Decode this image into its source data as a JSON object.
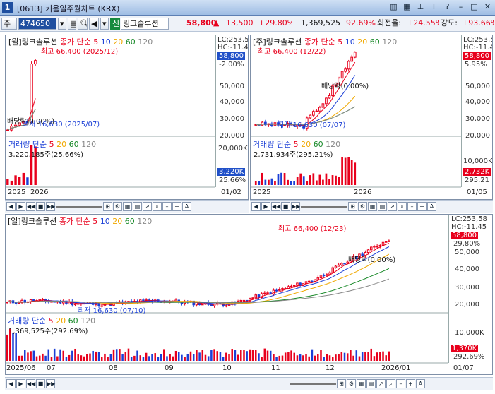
{
  "window": {
    "number": "1",
    "title": "[0613] 키움일주월차트 (KRX)"
  },
  "toolbar": {
    "market": "주",
    "code": "474650",
    "badge": "신",
    "name": "링크솔루션",
    "price": "58,800",
    "change": "13,500",
    "change_pct": "+29.80%",
    "volume": "1,369,525",
    "volume_pct": "92.69%",
    "turnover_label": "회전율:",
    "turnover": "+24.55%",
    "strength_label": "강도:",
    "strength": "+93.66%"
  },
  "panels": {
    "monthly": {
      "title": "[월]링크솔루션",
      "ma_label": "종가 단순",
      "ma": [
        "5",
        "10",
        "20",
        "60",
        "120"
      ],
      "high": "최고 66,400 (2025/12)",
      "low": "최저 16,630 (2025/07)",
      "low_marker": "배당락(0.00%)",
      "lc": "LC:253,5",
      "hc": "HC:-11.4",
      "price_tag": "58,800",
      "pct_tag": "-2.00%",
      "yticks": [
        "50,000",
        "40,000",
        "30,000",
        "20,000"
      ],
      "vol_title": "거래량",
      "vol_ma_label": "단순",
      "vol_ma": [
        "5",
        "20",
        "60",
        "120"
      ],
      "vol_value": "3,220,185주(25.66%)",
      "vol_ytick": "20,000K",
      "vol_tag": "3,220K",
      "vol_pct": "25.66%",
      "xlabels": [
        "2025",
        "2026"
      ],
      "date": "01/02"
    },
    "weekly": {
      "title": "[주]링크솔루션",
      "ma_label": "종가 단순",
      "ma": [
        "5",
        "10",
        "20",
        "60",
        "120"
      ],
      "high": "최고 66,400 (12/22)",
      "low": "최저 16,630 (07/07)",
      "div": "배당락(0.00%)",
      "lc": "LC:253,5",
      "hc": "HC:-11.4",
      "price_tag": "58,800",
      "pct_tag": "5.95%",
      "yticks": [
        "50,000",
        "40,000",
        "30,000",
        "20,000"
      ],
      "vol_title": "거래량",
      "vol_ma_label": "단순",
      "vol_ma": [
        "5",
        "20",
        "60",
        "120"
      ],
      "vol_value": "2,731,934주(295.21%)",
      "vol_ytick": "10,000K",
      "vol_tag": "2,732K",
      "vol_pct": "295.21",
      "xlabels": [
        "2025",
        "2026"
      ],
      "date": "01/05"
    },
    "daily": {
      "title": "[일]링크솔루션",
      "ma_label": "종가 단순",
      "ma": [
        "5",
        "10",
        "20",
        "60",
        "120"
      ],
      "high": "최고 66,400 (12/23)",
      "low": "최저 16,630 (07/10)",
      "div": "배당락(0.00%)",
      "lc": "LC:253,58",
      "hc": "HC:-11.45",
      "price_tag": "58,800",
      "pct_tag": "29.80%",
      "yticks": [
        "50,000",
        "40,000",
        "30,000",
        "20,000"
      ],
      "vol_title": "거래량",
      "vol_ma_label": "단순",
      "vol_ma": [
        "5",
        "20",
        "60",
        "120"
      ],
      "vol_value": "1,369,525주(292.69%)",
      "vol_ytick": "10,000K",
      "vol_tag": "1,370K",
      "vol_pct": "292.69%",
      "xlabels": [
        "2025/06",
        "07",
        "08",
        "09",
        "10",
        "11",
        "12",
        "2026/01"
      ],
      "date": "01/07"
    }
  },
  "colors": {
    "up": "#e8001c",
    "down": "#1b3fd6",
    "ma5": "#e8001c",
    "ma10": "#1b3fd6",
    "ma20": "#f0a800",
    "ma60": "#1a8a2a",
    "ma120": "#888888"
  },
  "icons": [
    "chart-icon",
    "search-icon",
    "speaker-icon",
    "pin-icon",
    "help-icon",
    "minimize-icon",
    "maximize-icon",
    "close-icon"
  ]
}
